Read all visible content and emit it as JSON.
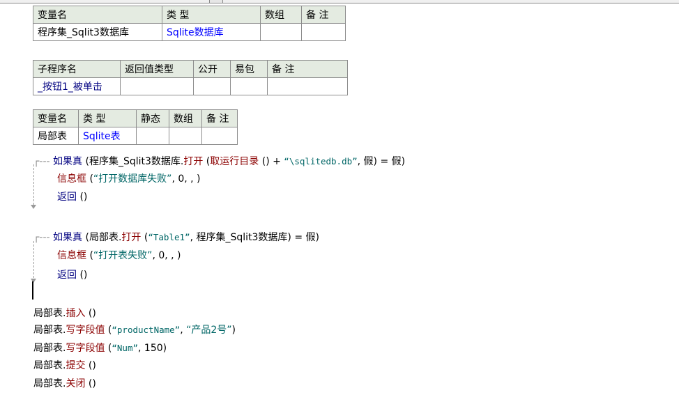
{
  "var_table": {
    "headers": [
      "变量名",
      "类 型",
      "数组",
      "备 注"
    ],
    "row": [
      "程序集_Sqlit3数据库",
      "Sqlite数据库",
      "",
      ""
    ]
  },
  "sub_table": {
    "headers": [
      "子程序名",
      "返回值类型",
      "公开",
      "易包",
      "备 注"
    ],
    "row": [
      "_按钮1_被单击",
      "",
      "",
      "",
      ""
    ]
  },
  "local_table": {
    "headers": [
      "变量名",
      "类 型",
      "静态",
      "数组",
      "备 注"
    ],
    "row": [
      "局部表",
      "Sqlite表",
      "",
      "",
      ""
    ]
  },
  "code": {
    "if1": {
      "kw": "如果真",
      "p1": " (程序集_Sqlit3数据库.",
      "fn": "打开",
      "p2": " (",
      "fn2": "取运行目录",
      "p3": " () + ",
      "str": "“\\sqlitedb.db”",
      "p4": ", 假) = 假)"
    },
    "if1_body1": {
      "fn": "信息框",
      "p1": " (",
      "str": "“打开数据库失败”",
      "p2": ", 0, , )"
    },
    "if1_body2": {
      "kw": "返回",
      "p1": " ()"
    },
    "if2": {
      "kw": "如果真",
      "p1": " (局部表.",
      "fn": "打开",
      "p2": " (",
      "str": "“Table1”",
      "p3": ", 程序集_Sqlit3数据库) = 假)"
    },
    "if2_body1": {
      "fn": "信息框",
      "p1": " (",
      "str": "“打开表失败”",
      "p2": ", 0, , )"
    },
    "if2_body2": {
      "kw": "返回",
      "p1": " ()"
    },
    "line_insert": {
      "obj": "局部表.",
      "fn": "插入",
      "p1": " ()"
    },
    "line_write1": {
      "obj": "局部表.",
      "fn": "写字段值",
      "p1": " (",
      "str1": "“productName”",
      "p2": ", ",
      "str2": "“产品2号”",
      "p3": ")"
    },
    "line_write2": {
      "obj": "局部表.",
      "fn": "写字段值",
      "p1": " (",
      "str1": "“Num”",
      "p2": ", 150)"
    },
    "line_commit": {
      "obj": "局部表.",
      "fn": "提交",
      "p1": " ()"
    },
    "line_close": {
      "obj": "局部表.",
      "fn": "关闭",
      "p1": " ()"
    }
  }
}
